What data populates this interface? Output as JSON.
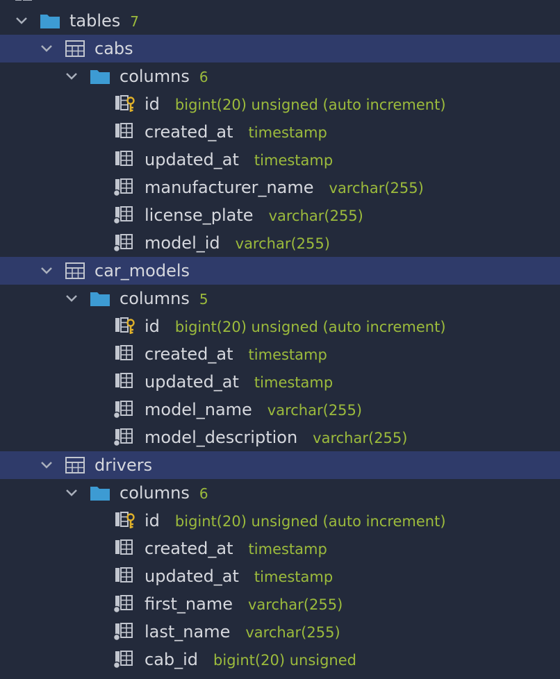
{
  "tables_folder": {
    "label": "tables",
    "count": "7"
  },
  "groups": [
    {
      "name": "cabs",
      "columns_label": "columns",
      "columns_count": "6",
      "columns": [
        {
          "name": "id",
          "type": "bigint(20) unsigned (auto increment)",
          "icon": "primary-key-column-icon"
        },
        {
          "name": "created_at",
          "type": "timestamp",
          "icon": "column-icon"
        },
        {
          "name": "updated_at",
          "type": "timestamp",
          "icon": "column-icon"
        },
        {
          "name": "manufacturer_name",
          "type": "varchar(255)",
          "icon": "not-null-column-icon"
        },
        {
          "name": "license_plate",
          "type": "varchar(255)",
          "icon": "not-null-column-icon"
        },
        {
          "name": "model_id",
          "type": "varchar(255)",
          "icon": "not-null-column-icon"
        }
      ]
    },
    {
      "name": "car_models",
      "columns_label": "columns",
      "columns_count": "5",
      "columns": [
        {
          "name": "id",
          "type": "bigint(20) unsigned (auto increment)",
          "icon": "primary-key-column-icon"
        },
        {
          "name": "created_at",
          "type": "timestamp",
          "icon": "column-icon"
        },
        {
          "name": "updated_at",
          "type": "timestamp",
          "icon": "column-icon"
        },
        {
          "name": "model_name",
          "type": "varchar(255)",
          "icon": "not-null-column-icon"
        },
        {
          "name": "model_description",
          "type": "varchar(255)",
          "icon": "not-null-column-icon"
        }
      ]
    },
    {
      "name": "drivers",
      "columns_label": "columns",
      "columns_count": "6",
      "columns": [
        {
          "name": "id",
          "type": "bigint(20) unsigned (auto increment)",
          "icon": "primary-key-column-icon"
        },
        {
          "name": "created_at",
          "type": "timestamp",
          "icon": "column-icon"
        },
        {
          "name": "updated_at",
          "type": "timestamp",
          "icon": "column-icon"
        },
        {
          "name": "first_name",
          "type": "varchar(255)",
          "icon": "not-null-column-icon"
        },
        {
          "name": "last_name",
          "type": "varchar(255)",
          "icon": "not-null-column-icon"
        },
        {
          "name": "cab_id",
          "type": "bigint(20) unsigned",
          "icon": "not-null-column-icon"
        }
      ]
    }
  ],
  "colors": {
    "background": "#232a3b",
    "selected_row": "#2f3b6a",
    "folder": "#3d9bd3",
    "type_text": "#9cbb3c",
    "key": "#e0b12a"
  }
}
